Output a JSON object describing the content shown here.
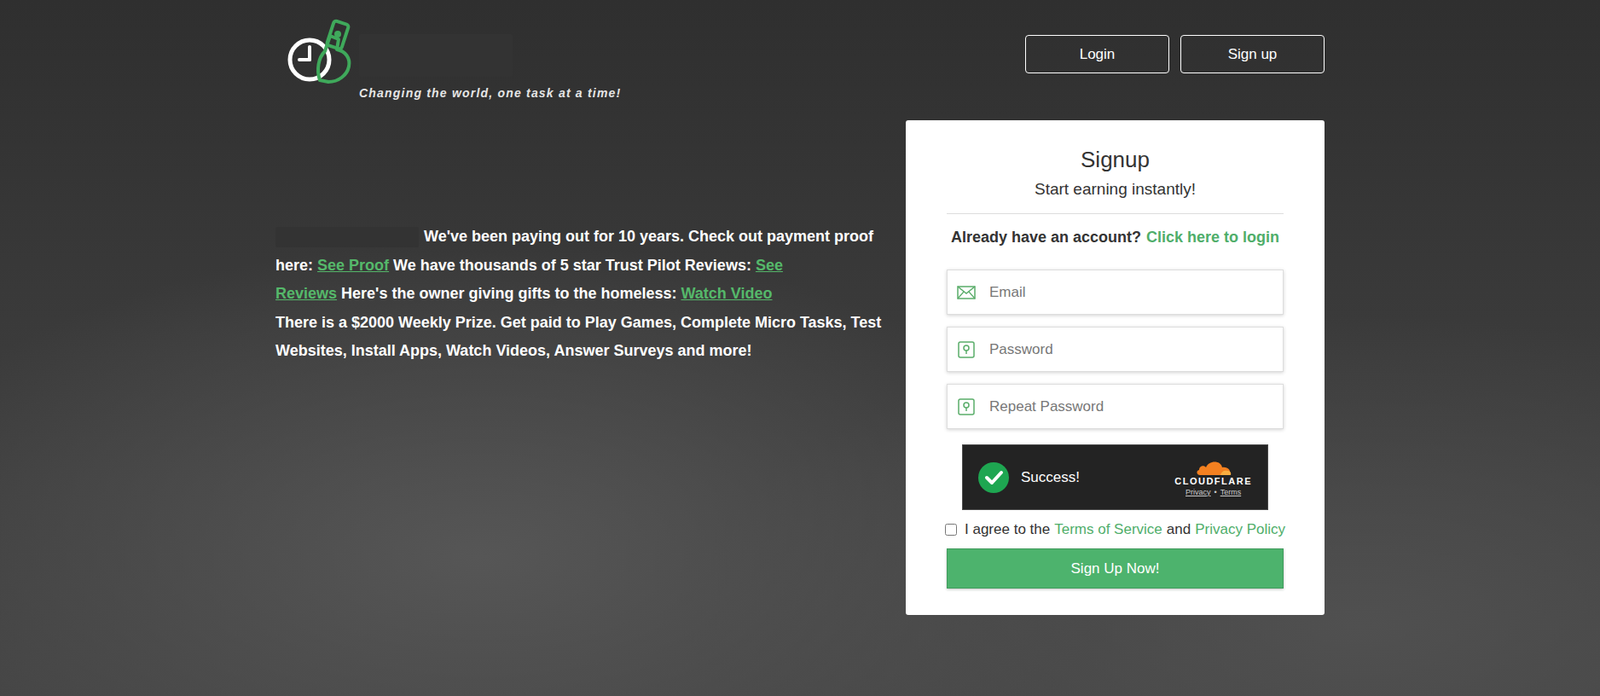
{
  "logo": {
    "tagline": "Changing the world, one task at a time!"
  },
  "nav": [
    {
      "label": "Login"
    },
    {
      "label": "Sign up"
    }
  ],
  "hero": {
    "paragraphs": [
      {
        "segments": [
          {
            "text": "We've been paying out for 10 years. Check out payment proof here:",
            "link": false
          },
          {
            "text": "See Proof",
            "link": true
          },
          {
            "text": "We have thousands of 5 star Trust Pilot Reviews:",
            "link": false
          },
          {
            "text": "See Reviews",
            "link": true
          },
          {
            "text": "Here's the owner giving gifts to the homeless:",
            "link": false
          },
          {
            "text": "Watch Video",
            "link": true
          }
        ]
      },
      {
        "segments": [
          {
            "text": "There is a $2000 Weekly Prize. Get paid to Play Games, Complete Micro Tasks, Test Websites, Install Apps, Watch Videos, Answer Surveys and more!",
            "link": false
          }
        ]
      }
    ]
  },
  "card": {
    "title": "Signup",
    "subtitle": "Start earning instantly!",
    "login_prompt": "Already have an account?",
    "login_link": "Click here to login",
    "fields": [
      {
        "placeholder": "Email",
        "kind": "email"
      },
      {
        "placeholder": "Password",
        "kind": "password"
      },
      {
        "placeholder": "Repeat Password",
        "kind": "password"
      }
    ],
    "captcha": {
      "status": "Success!",
      "verified": true,
      "brand": "CLOUDFLARE",
      "links": [
        "Privacy",
        "Terms"
      ],
      "separator": "•"
    },
    "agree": {
      "checked": false,
      "prefix": "I agree to the",
      "terms": "Terms of Service",
      "joiner": "and",
      "privacy": "Privacy Policy"
    },
    "submit": "Sign Up Now!"
  }
}
